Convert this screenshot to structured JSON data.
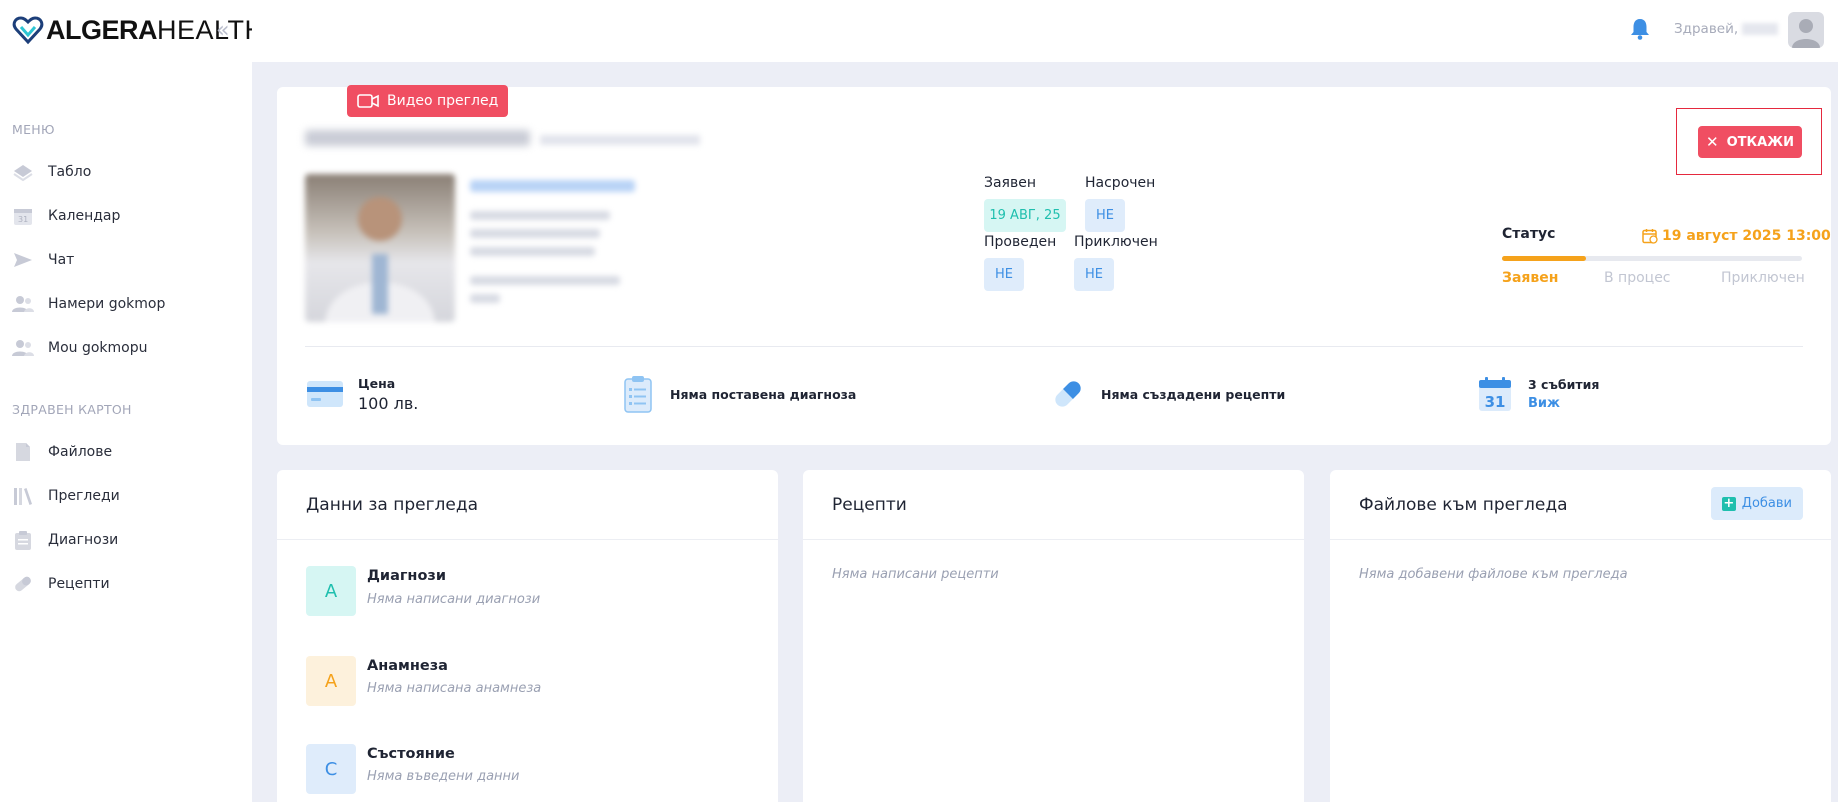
{
  "logo": {
    "bold": "ALGERA",
    "light": "HEALTH"
  },
  "sidebar": {
    "menu_title": "МЕНЮ",
    "menu": [
      {
        "label": "Табло",
        "icon": "dashboard-icon"
      },
      {
        "label": "Календар",
        "icon": "calendar-icon"
      },
      {
        "label": "Чат",
        "icon": "send-icon"
      },
      {
        "label": "Намери gokmop",
        "icon": "people-icon"
      },
      {
        "label": "Mou gokmopu",
        "icon": "doctors-icon"
      }
    ],
    "card_title": "ЗДРАВЕН КАРТОН",
    "card": [
      {
        "label": "Файлове",
        "icon": "file-icon"
      },
      {
        "label": "Прегледи",
        "icon": "books-icon"
      },
      {
        "label": "Диагнози",
        "icon": "clipboard-icon"
      },
      {
        "label": "Рецепти",
        "icon": "pill-icon"
      }
    ]
  },
  "header": {
    "greeting": "Здравей,"
  },
  "appointment": {
    "video_tag": "Видео преглед",
    "cancel_label": "ОТКАЖИ",
    "requested_label": "Заявен",
    "requested_value": "19 АВГ, 25",
    "scheduled_label": "Насрочен",
    "scheduled_value": "НЕ",
    "conducted_label": "Проведен",
    "conducted_value": "НЕ",
    "finished_label": "Приключен",
    "finished_value": "НЕ",
    "status_title": "Статус",
    "status_date": "19 август 2025 13:00",
    "progress": 0.28,
    "steps": [
      "Заявен",
      "В процес",
      "Приключен"
    ],
    "accent": "#f5a21b"
  },
  "info": {
    "price_label": "Цена",
    "price_value": "100 лв.",
    "diagnosis": "Няма поставена диагноза",
    "prescriptions": "Няма създадени рецепти",
    "events_label": "3 събития",
    "events_link": "Виж",
    "calendar_day": "31"
  },
  "exam_card": {
    "title": "Данни за прегледа",
    "rows": [
      {
        "badge": "A",
        "title": "Диагнози",
        "sub": "Няма написани диагнози"
      },
      {
        "badge": "A",
        "title": "Анамнеза",
        "sub": "Няма написана анамнеза"
      },
      {
        "badge": "C",
        "title": "Състояние",
        "sub": "Няма въведени данни"
      }
    ]
  },
  "rx_card": {
    "title": "Рецепти",
    "empty": "Няма написани рецепти"
  },
  "files_card": {
    "title": "Файлове към прегледа",
    "add_label": "Добави",
    "empty": "Няма добавени файлове към прегледа"
  }
}
